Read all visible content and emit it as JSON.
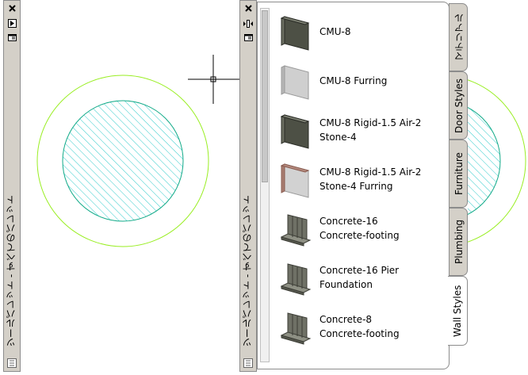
{
  "left_palette": {
    "close_icon": "close-icon",
    "autohide_icon": "autohide-icon",
    "properties_icon": "properties-icon",
    "title": "ツールパレット - すべてのパレット"
  },
  "right_palette": {
    "close_icon": "close-icon",
    "autohide_icon": "autohide-icon",
    "properties_icon": "properties-icon",
    "title": "ツールパレット - すべてのパレット",
    "tools": [
      {
        "label": "CMU-8",
        "style": "dark"
      },
      {
        "label": "CMU-8 Furring",
        "style": "light"
      },
      {
        "label": "CMU-8 Rigid-1.5 Air-2\nStone-4",
        "style": "dark"
      },
      {
        "label": "CMU-8 Rigid-1.5 Air-2\nStone-4 Furring",
        "style": "light-red"
      },
      {
        "label": "Concrete-16\nConcrete-footing",
        "style": "footing"
      },
      {
        "label": "Concrete-16 Pier\nFoundation",
        "style": "footing"
      },
      {
        "label": "Concrete-8\nConcrete-footing",
        "style": "footing"
      }
    ],
    "tabs": [
      {
        "label": "マテリアル",
        "active": false
      },
      {
        "label": "Door Styles",
        "active": false
      },
      {
        "label": "Furniture",
        "active": false
      },
      {
        "label": "Plumbing",
        "active": false
      },
      {
        "label": "Wall Styles",
        "active": true
      }
    ]
  },
  "colors": {
    "outer_circle": "#99ee22",
    "inner_circle": "#11aa88",
    "hatch": "#33cccc",
    "crosshair": "#000000"
  }
}
